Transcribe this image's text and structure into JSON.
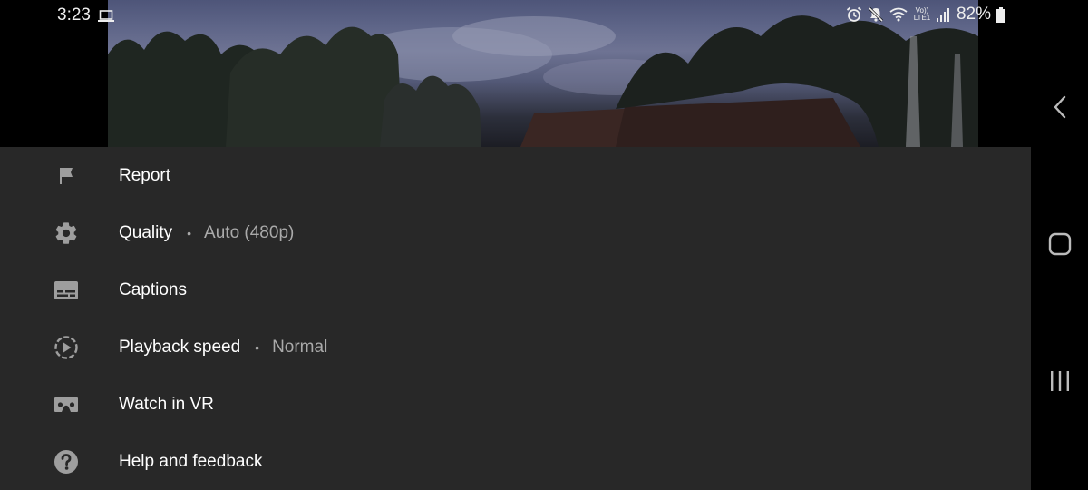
{
  "status_bar": {
    "time": "3:23",
    "battery_percent": "82%",
    "icons": [
      "laptop-icon",
      "alarm-icon",
      "mute-icon",
      "wifi-icon",
      "volte-icon",
      "signal-icon",
      "battery-icon"
    ],
    "volte_text": "Vo)) LTE1"
  },
  "menu": {
    "items": [
      {
        "label": "Report",
        "icon": "flag-icon"
      },
      {
        "label": "Quality",
        "icon": "gear-icon",
        "value": "Auto (480p)"
      },
      {
        "label": "Captions",
        "icon": "captions-icon"
      },
      {
        "label": "Playback speed",
        "icon": "playback-speed-icon",
        "value": "Normal"
      },
      {
        "label": "Watch in VR",
        "icon": "vr-headset-icon"
      },
      {
        "label": "Help and feedback",
        "icon": "help-icon"
      }
    ],
    "separator": "•"
  },
  "nav_bar": {
    "buttons": [
      "back-button",
      "home-button",
      "recents-button"
    ]
  },
  "colors": {
    "sheet_bg": "#282828",
    "text_primary": "#ffffff",
    "text_secondary": "#aaaaaa",
    "icon": "#9e9e9e"
  }
}
